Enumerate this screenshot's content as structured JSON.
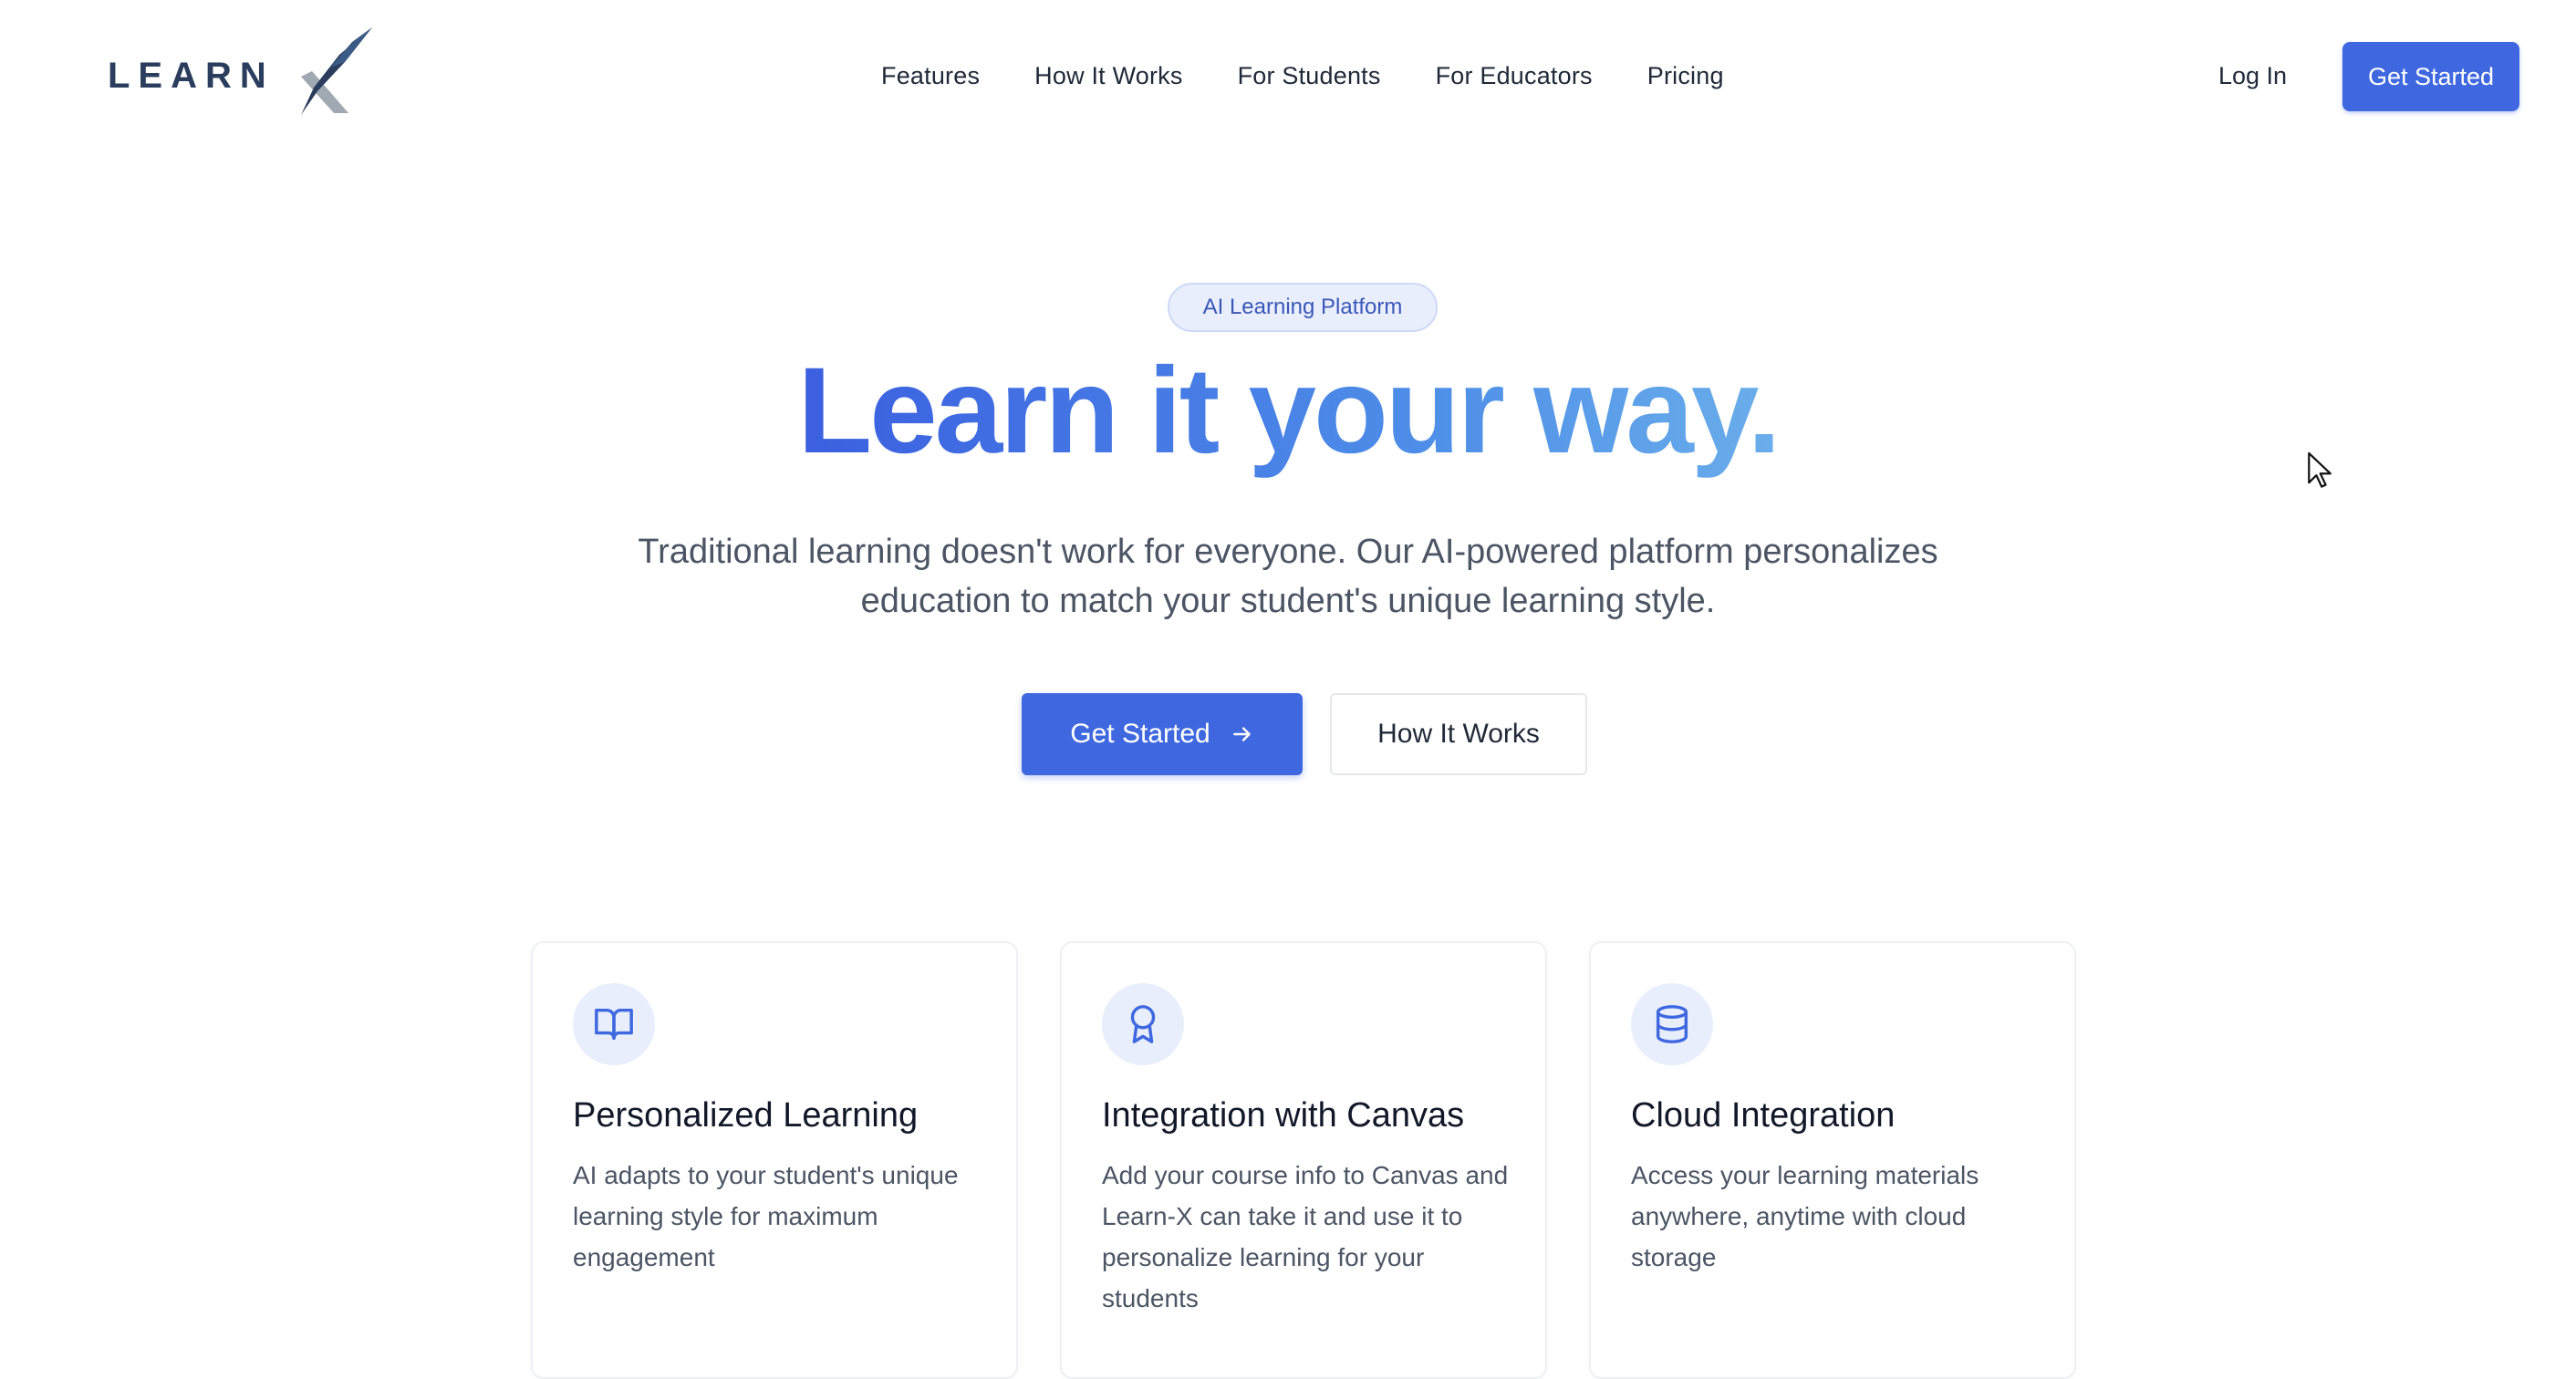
{
  "brand": {
    "logo_text": "LEARN",
    "logo_mark": "X"
  },
  "nav": {
    "links": [
      "Features",
      "How It Works",
      "For Students",
      "For Educators",
      "Pricing"
    ],
    "login_label": "Log In",
    "cta_label": "Get Started"
  },
  "hero": {
    "badge": "AI Learning Platform",
    "headline": "Learn it your way.",
    "subheadline": "Traditional learning doesn't work for everyone. Our AI-powered platform personalizes education to match your student's unique learning style.",
    "primary_button": "Get Started",
    "secondary_button": "How It Works"
  },
  "features": [
    {
      "icon": "book-open-icon",
      "title": "Personalized Learning",
      "description": "AI adapts to your student's unique learning style for maximum engagement"
    },
    {
      "icon": "award-icon",
      "title": "Integration with Canvas",
      "description": "Add your course info to Canvas and Learn-X can take it and use it to personalize learning for your students"
    },
    {
      "icon": "database-icon",
      "title": "Cloud Integration",
      "description": "Access your learning materials anywhere, anytime with cloud storage"
    }
  ],
  "colors": {
    "primary": "#3f68e0",
    "badge_bg": "#e8eefc",
    "logo_dark": "#2a3d5c",
    "logo_gray": "#9aa3ad",
    "headline_gradient_start": "#3b5fe0",
    "headline_gradient_end": "#6aaeea"
  }
}
